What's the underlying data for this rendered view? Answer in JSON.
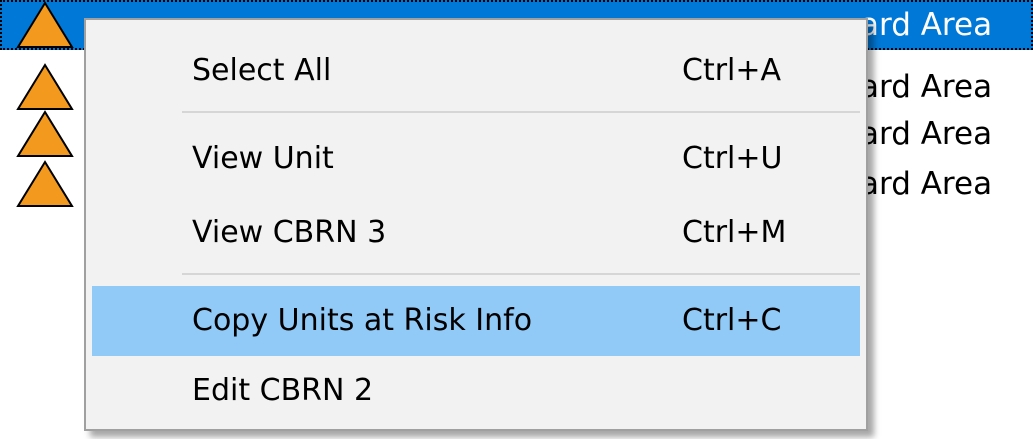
{
  "list": {
    "rows": [
      {
        "type_text": "ard Area",
        "selected": true
      },
      {
        "type_text": "ard Area",
        "selected": false
      },
      {
        "type_text": "ard Area",
        "selected": false
      },
      {
        "type_text": "ard Area",
        "selected": false
      }
    ],
    "icon": "hazard-triangle-icon",
    "colors": {
      "selection": "#0078d7",
      "icon_fill": "#f39a1e",
      "icon_outline": "#000000"
    }
  },
  "context_menu": {
    "items": [
      {
        "label": "Select All",
        "shortcut": "Ctrl+A"
      },
      {
        "label": "View Unit",
        "shortcut": "Ctrl+U"
      },
      {
        "label": "View CBRN 3",
        "shortcut": "Ctrl+M"
      },
      {
        "label": "Copy Units at Risk Info",
        "shortcut": "Ctrl+C",
        "highlighted": true
      },
      {
        "label": "Edit CBRN 2",
        "shortcut": ""
      }
    ],
    "colors": {
      "background": "#f2f2f2",
      "highlight": "#91c9f7",
      "border": "#a0a0a0"
    }
  }
}
